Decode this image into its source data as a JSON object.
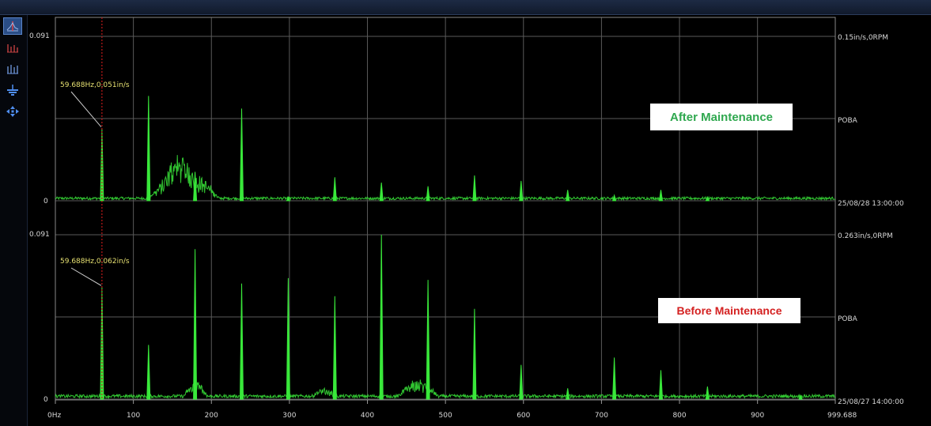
{
  "colors": {
    "signal": "#39e83a",
    "grid": "#5a5a5a",
    "cursor": "#c01a1a",
    "cursor_text": "#e6e071",
    "after_label": "#2fa84f",
    "before_label": "#d42121"
  },
  "toolbar": {
    "items": [
      {
        "icon": "cursor-mode-icon",
        "active": true
      },
      {
        "icon": "harmonic-cursor-icon",
        "active": false
      },
      {
        "icon": "sideband-cursor-icon",
        "active": false
      },
      {
        "icon": "ground-marker-icon",
        "active": false
      },
      {
        "icon": "move-icon",
        "active": false
      }
    ]
  },
  "x_axis": {
    "ticks": [
      "0Hz",
      "100",
      "200",
      "300",
      "400",
      "500",
      "600",
      "700",
      "800",
      "900",
      "999.688"
    ],
    "tick_values": [
      0,
      100,
      200,
      300,
      400,
      500,
      600,
      700,
      800,
      900,
      999.688
    ]
  },
  "panels": {
    "top": {
      "y_max_label": "0.091",
      "y_min_label": "0",
      "right_scale": "0.15in/s,0RPM",
      "point": "POBA",
      "timestamp": "25/08/28 13:00:00",
      "cursor_label": "59.688Hz,0.051in/s",
      "annotation": "After Maintenance"
    },
    "bottom": {
      "y_max_label": "0.091",
      "y_min_label": "0",
      "right_scale": "0.263in/s,0RPM",
      "point": "POBA",
      "timestamp": "25/08/27 14:00:00",
      "cursor_label": "59.688Hz,0.062in/s",
      "annotation": "Before Maintenance"
    }
  },
  "chart_data": [
    {
      "type": "line",
      "title": "",
      "xlabel": "",
      "ylabel": "",
      "xlim": [
        0,
        999.688
      ],
      "ylim": [
        0,
        0.091
      ],
      "cursor_x": 59.688,
      "series": [
        {
          "x": [
            59.688,
            119.4,
            179.1,
            238.8,
            298.5,
            358.2,
            417.9,
            477.6,
            537.3,
            597.0,
            656.7,
            716.4,
            776.1,
            835.8
          ],
          "values": [
            0.04,
            0.058,
            0.016,
            0.051,
            0.002,
            0.013,
            0.01,
            0.008,
            0.014,
            0.011,
            0.006,
            0.003,
            0.006,
            0.002
          ]
        }
      ],
      "noise_bumps": [
        {
          "x_from": 120,
          "x_to": 210,
          "peak": 0.016
        },
        {
          "x_from": 140,
          "x_to": 175,
          "peak": 0.012
        }
      ],
      "noise_floor": 0.0015
    },
    {
      "type": "line",
      "title": "",
      "xlabel": "",
      "ylabel": "",
      "xlim": [
        0,
        999.688
      ],
      "ylim": [
        0,
        0.091
      ],
      "cursor_x": 59.688,
      "series": [
        {
          "x": [
            59.688,
            119.4,
            179.1,
            238.8,
            298.5,
            358.2,
            417.9,
            477.6,
            537.3,
            597.0,
            656.7,
            716.4,
            776.1,
            835.8,
            955.2
          ],
          "values": [
            0.062,
            0.03,
            0.083,
            0.064,
            0.067,
            0.057,
            0.091,
            0.066,
            0.05,
            0.019,
            0.006,
            0.023,
            0.016,
            0.007,
            0.002
          ]
        }
      ],
      "noise_bumps": [
        {
          "x_from": 165,
          "x_to": 195,
          "peak": 0.008
        },
        {
          "x_from": 330,
          "x_to": 360,
          "peak": 0.004
        },
        {
          "x_from": 440,
          "x_to": 490,
          "peak": 0.009
        }
      ],
      "noise_floor": 0.0018
    }
  ]
}
